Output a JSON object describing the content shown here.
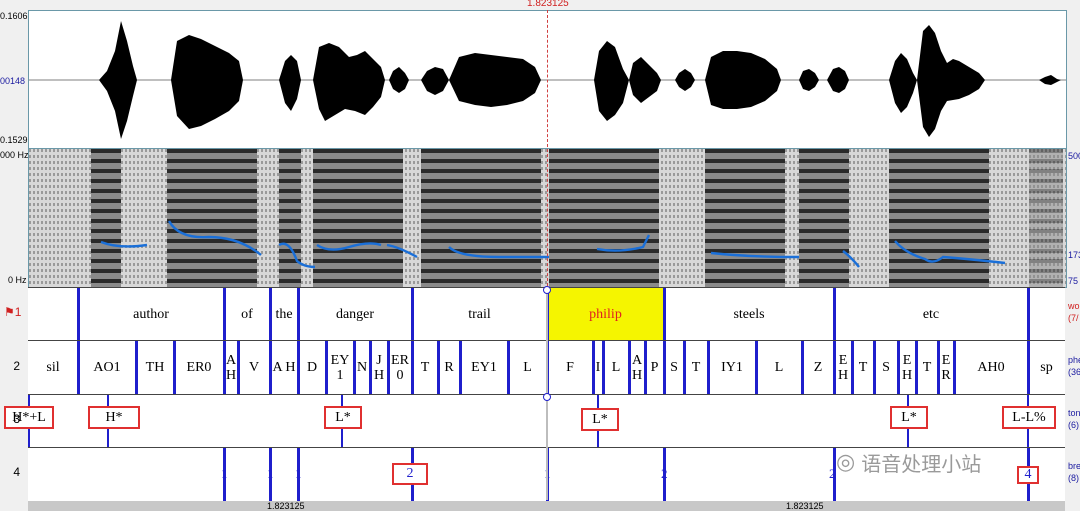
{
  "cursor_time": "1.823125",
  "waveform": {
    "max_label": "0.1606",
    "mid_label": "00148",
    "min_label": "0.1529"
  },
  "spectrogram": {
    "top_label": "000 Hz",
    "bottom_label": "0 Hz",
    "right_top": "500",
    "right_mid": "173",
    "right_bottom": "75"
  },
  "tiers": [
    {
      "number": "1",
      "name": "wo",
      "count": "(7/"
    },
    {
      "number": "2",
      "name": "phe",
      "count": "(36"
    },
    {
      "number": "3",
      "name": "ton",
      "count": "(6)"
    },
    {
      "number": "4",
      "name": "bre",
      "count": "(8)"
    }
  ],
  "words": [
    "author",
    "of",
    "the",
    "danger",
    "trail",
    "philip",
    "steels",
    "etc"
  ],
  "phones": [
    "sil",
    "AO1",
    "TH",
    "ER0",
    "A H",
    "V",
    "A H",
    "D",
    "EY 1",
    "N",
    "J H",
    "ER 0",
    "T",
    "R",
    "EY1",
    "L",
    "F",
    "I",
    "L",
    "A H",
    "P",
    "S",
    "T",
    "IY1",
    "L",
    "Z",
    "E H",
    "T",
    "S",
    "E H",
    "T",
    "E R",
    "AH0",
    "sp"
  ],
  "tones": [
    "H*+L",
    "H*",
    "L*",
    "L*",
    "L*",
    "L-L%"
  ],
  "breaks": [
    "1",
    "1",
    "1",
    "2",
    "1",
    "2",
    "2",
    "4"
  ],
  "bottom_times": [
    "1.823125",
    "1.823125"
  ],
  "watermark": "语音处理小站",
  "colors": {
    "selection": "#f5f500",
    "boundary": "#1f1fcc",
    "tone_box": "#e03030",
    "pitch": "#1a6fd8"
  }
}
